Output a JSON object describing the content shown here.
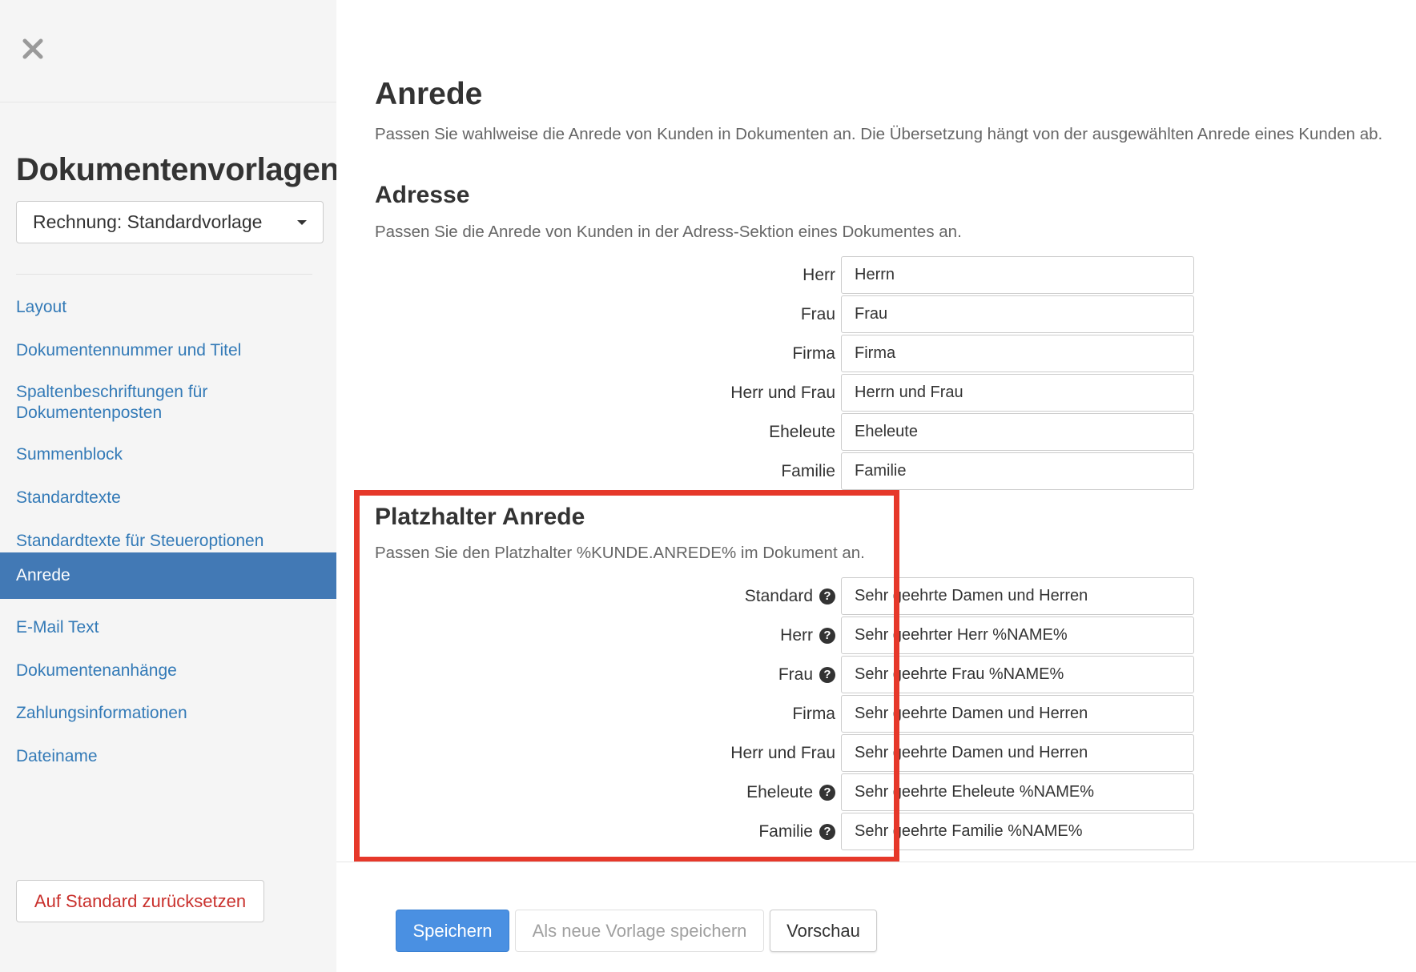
{
  "sidebar": {
    "close_icon": "close-icon",
    "title": "Dokumentenvorlagen",
    "template_select": {
      "value": "Rechnung: Standardvorlage"
    },
    "nav": [
      {
        "label": "Layout"
      },
      {
        "label": "Dokumentennummer und Titel"
      },
      {
        "label": "Spaltenbeschriftungen für Dokumentenposten"
      },
      {
        "label": "Summenblock"
      },
      {
        "label": "Standardtexte"
      },
      {
        "label": "Standardtexte für Steueroptionen"
      },
      {
        "label": "Anrede",
        "active": true
      },
      {
        "label": "E-Mail Text"
      },
      {
        "label": "Dokumentenanhänge"
      },
      {
        "label": "Zahlungsinformationen"
      },
      {
        "label": "Dateiname"
      }
    ],
    "reset_label": "Auf Standard zurücksetzen"
  },
  "main": {
    "title": "Anrede",
    "description": "Passen Sie wahlweise die Anrede von Kunden in Dokumenten an. Die Übersetzung hängt von der ausgewählten Anrede eines Kunden ab.",
    "address": {
      "title": "Adresse",
      "description": "Passen Sie die Anrede von Kunden in der Adress-Sektion eines Dokumentes an.",
      "fields": [
        {
          "label": "Herr",
          "value": "Herrn"
        },
        {
          "label": "Frau",
          "value": "Frau"
        },
        {
          "label": "Firma",
          "value": "Firma"
        },
        {
          "label": "Herr und Frau",
          "value": "Herrn und Frau"
        },
        {
          "label": "Eheleute",
          "value": "Eheleute"
        },
        {
          "label": "Familie",
          "value": "Familie"
        }
      ]
    },
    "placeholder": {
      "title": "Platzhalter Anrede",
      "description": "Passen Sie den Platzhalter %KUNDE.ANREDE% im Dokument an.",
      "fields": [
        {
          "label": "Standard",
          "value": "Sehr geehrte Damen und Herren",
          "help": "?"
        },
        {
          "label": "Herr",
          "value": "Sehr geehrter Herr %NAME%",
          "help": "?"
        },
        {
          "label": "Frau",
          "value": "Sehr geehrte Frau %NAME%",
          "help": "?"
        },
        {
          "label": "Firma",
          "value": "Sehr geehrte Damen und Herren"
        },
        {
          "label": "Herr und Frau",
          "value": "Sehr geehrte Damen und Herren"
        },
        {
          "label": "Eheleute",
          "value": "Sehr geehrte Eheleute %NAME%",
          "help": "?"
        },
        {
          "label": "Familie",
          "value": "Sehr geehrte Familie %NAME%",
          "help": "?"
        }
      ]
    },
    "highlight_color": "#e6382a"
  },
  "footer": {
    "save_label": "Speichern",
    "save_as_new_label": "Als neue Vorlage speichern",
    "preview_label": "Vorschau"
  },
  "colors": {
    "link": "#337ab7",
    "active_nav": "#4279b5",
    "primary_button": "#4a90e2",
    "danger_text": "#c9302c"
  }
}
